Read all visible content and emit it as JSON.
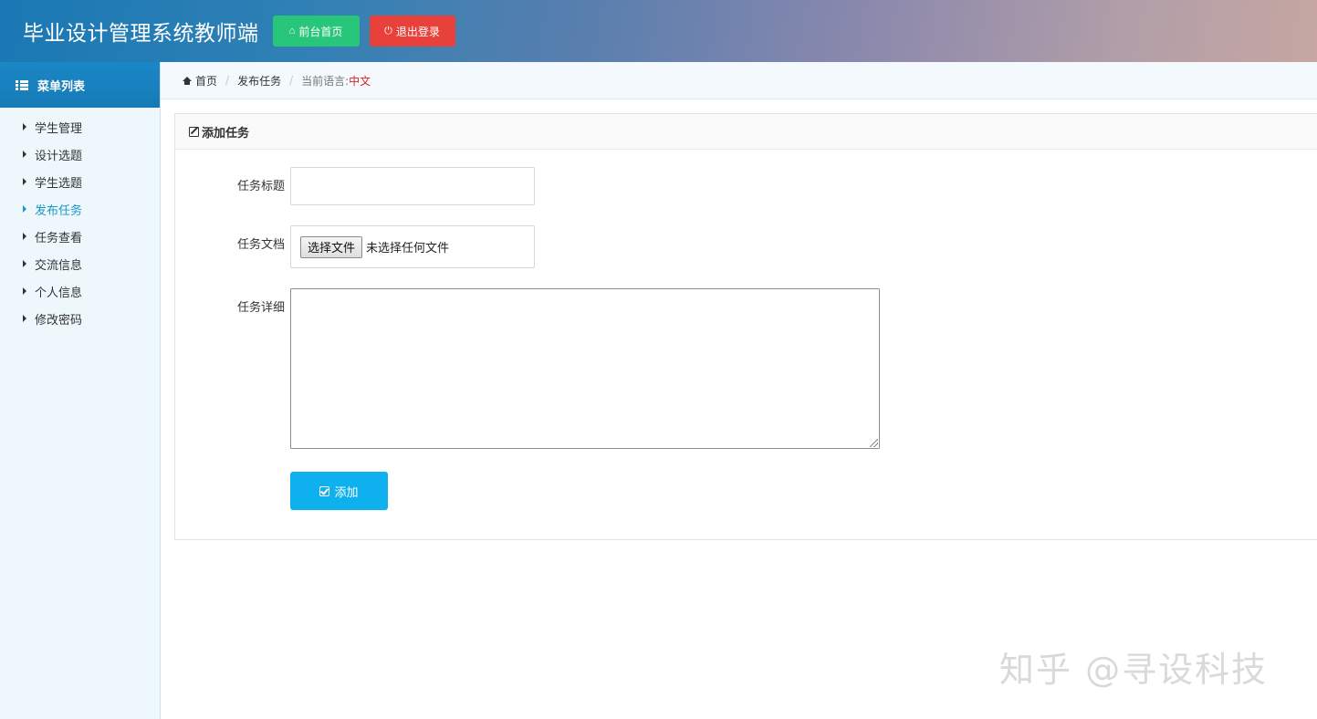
{
  "header": {
    "app_title": "毕业设计管理系统教师端",
    "home_button": "前台首页",
    "logout_button": "退出登录",
    "home_button_color": "#27c67a",
    "logout_button_color": "#e8413b"
  },
  "sidebar": {
    "title": "菜单列表",
    "items": [
      {
        "label": "学生管理",
        "active": false
      },
      {
        "label": "设计选题",
        "active": false
      },
      {
        "label": "学生选题",
        "active": false
      },
      {
        "label": "发布任务",
        "active": true
      },
      {
        "label": "任务查看",
        "active": false
      },
      {
        "label": "交流信息",
        "active": false
      },
      {
        "label": "个人信息",
        "active": false
      },
      {
        "label": "修改密码",
        "active": false
      }
    ],
    "active_color": "#1a96c9"
  },
  "breadcrumb": {
    "home": "首页",
    "current_page": "发布任务",
    "language_label": "当前语言:",
    "language_value": "中文"
  },
  "form": {
    "panel_title": "添加任务",
    "title_label": "任务标题",
    "title_value": "",
    "doc_label": "任务文档",
    "file_button": "选择文件",
    "file_status": "未选择任何文件",
    "detail_label": "任务详细",
    "detail_value": "",
    "submit_button": "添加",
    "submit_color": "#0fb0ee"
  },
  "watermark": {
    "text": "知乎 @寻设科技"
  },
  "icons": {
    "header_home": "home-icon",
    "header_logout": "power-icon",
    "sidebar_title": "list-icon",
    "menu_bullet": "caret-right-icon",
    "breadcrumb_home": "home-icon",
    "panel_title": "edit-icon",
    "submit": "check-square-icon"
  }
}
